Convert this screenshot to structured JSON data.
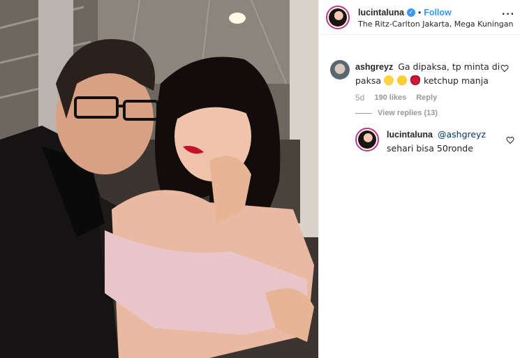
{
  "post": {
    "username": "lucintaluna",
    "verified_icon": "verified-badge-icon",
    "dot": "•",
    "follow_label": "Follow",
    "location": "The Ritz-Carlton Jakarta, Mega Kuningan",
    "more_icon": "more-options-icon"
  },
  "comments": [
    {
      "username": "ashgreyz",
      "text_before": "Ga dipaksa, tp minta di paksa",
      "emojis": [
        "grinning-sweat-emoji",
        "winking-kiss-emoji",
        "kiss-lips-emoji"
      ],
      "text_after": "ketchup manja",
      "time": "5d",
      "likes": "190 likes",
      "reply_label": "Reply",
      "view_replies": "View replies (13)"
    }
  ],
  "reply": {
    "username": "lucintaluna",
    "mention": "@ashgreyz",
    "text": "sehari bisa 50ronde"
  },
  "colors": {
    "accent": "#3897f0",
    "muted": "#999999",
    "text": "#262626",
    "story_ring": "#c13584"
  }
}
